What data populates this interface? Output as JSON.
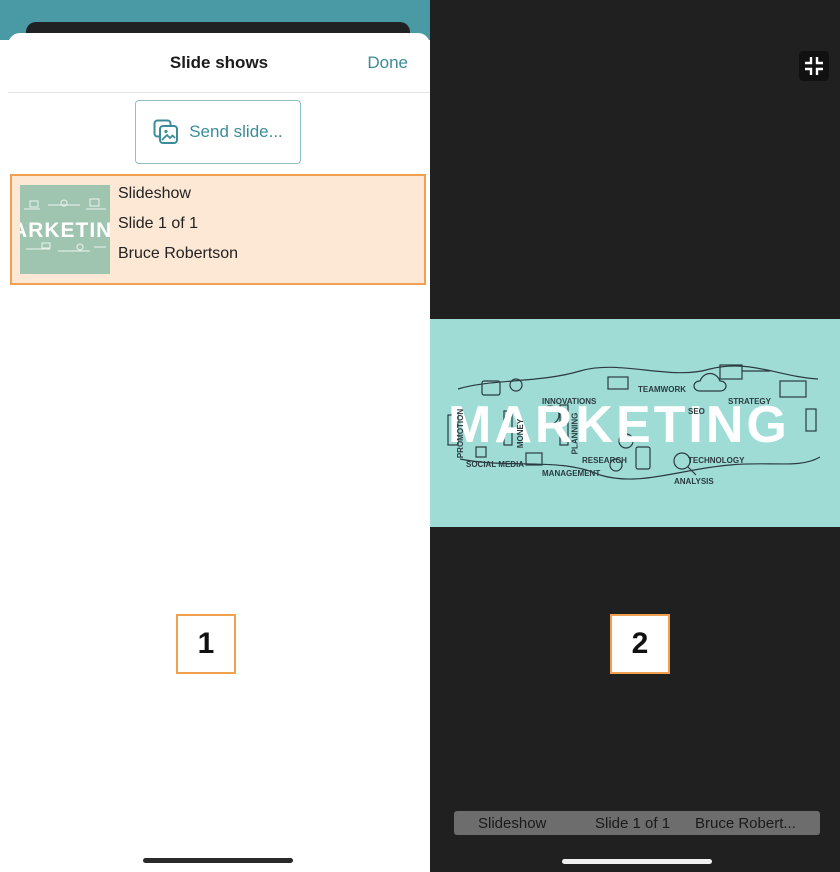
{
  "left_panel": {
    "title": "Slide shows",
    "done_label": "Done",
    "send_label": "Send slide...",
    "slide_item": {
      "thumbnail_word": "ARKETIN",
      "name": "Slideshow",
      "position": "Slide 1 of 1",
      "presenter": "Bruce Robertson"
    },
    "marker_label": "1"
  },
  "right_panel": {
    "slide_word": "MARKETING",
    "slide_tags": [
      "INNOVATIONS",
      "TEAMWORK",
      "STRATEGY",
      "SEO",
      "MONEY",
      "PLANNING",
      "PROMOTION",
      "SOCIAL MEDIA",
      "RESEARCH",
      "MANAGEMENT",
      "TECHNOLOGY",
      "ANALYSIS"
    ],
    "caption": {
      "name": "Slideshow",
      "position": "Slide 1 of 1",
      "presenter": "Bruce Robert..."
    },
    "marker_label": "2"
  },
  "colors": {
    "accent": "#3a8c99",
    "highlight_fill": "#fde8d6",
    "highlight_border": "#f0a04e",
    "slide_bg": "#9fdcd6",
    "dark_bg": "#202020"
  },
  "icons": {
    "send": "images-send-icon",
    "collapse": "collapse-fullscreen-icon"
  }
}
